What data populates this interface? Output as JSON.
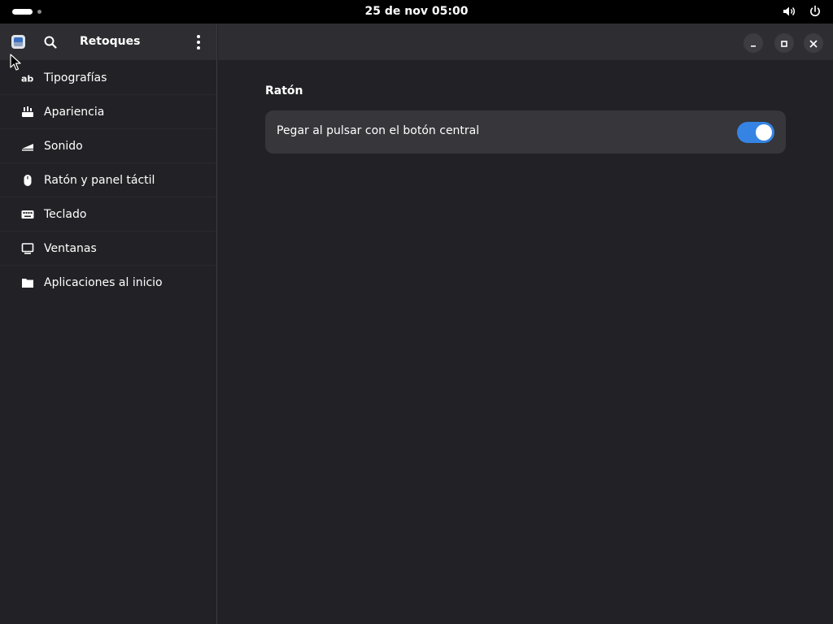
{
  "topbar": {
    "clock": "25 de nov  05:00",
    "icons": [
      "activities-indicator",
      "volume-icon",
      "power-icon"
    ]
  },
  "sidebar": {
    "title": "Retoques",
    "items": [
      {
        "label": "Tipografías",
        "icon": "font-icon"
      },
      {
        "label": "Apariencia",
        "icon": "appearance-icon"
      },
      {
        "label": "Sonido",
        "icon": "sound-icon"
      },
      {
        "label": "Ratón y panel táctil",
        "icon": "mouse-icon"
      },
      {
        "label": "Teclado",
        "icon": "keyboard-icon"
      },
      {
        "label": "Ventanas",
        "icon": "window-icon"
      },
      {
        "label": "Aplicaciones al inicio",
        "icon": "folder-icon"
      }
    ]
  },
  "main": {
    "section_title": "Ratón",
    "settings": [
      {
        "label": "Pegar al pulsar con el botón central",
        "enabled": true
      }
    ]
  },
  "colors": {
    "accent": "#3584e4",
    "window_bg": "#222226",
    "header_bg": "#2e2e32",
    "card_bg": "#36363b",
    "topbar_bg": "#000000"
  }
}
